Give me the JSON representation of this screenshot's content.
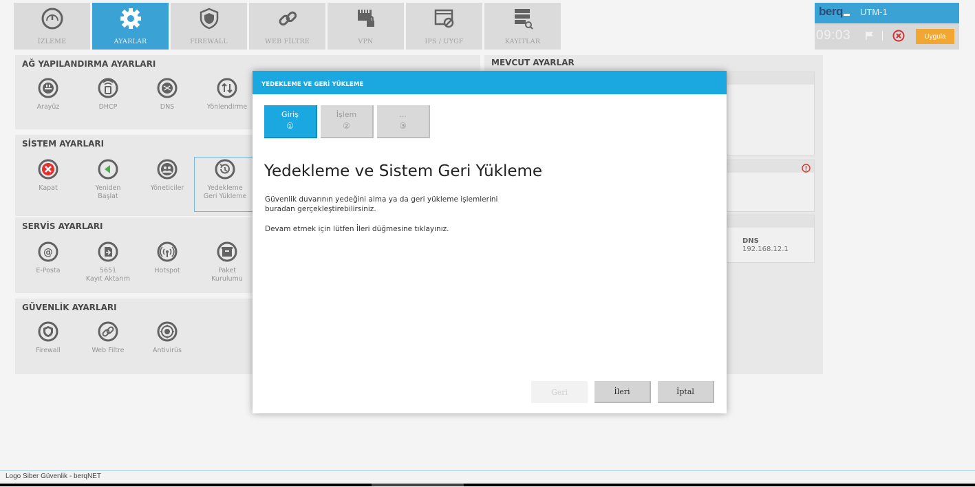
{
  "nav": {
    "items": [
      {
        "label": "İZLEME",
        "icon": "gauge-icon"
      },
      {
        "label": "AYARLAR",
        "icon": "gear-icon"
      },
      {
        "label": "FIREWALL",
        "icon": "shield-icon"
      },
      {
        "label": "WEB FİLTRE",
        "icon": "link-icon"
      },
      {
        "label": "VPN",
        "icon": "network-lock-icon"
      },
      {
        "label": "IPS / UYGF",
        "icon": "window-block-icon"
      },
      {
        "label": "KAYITLAR",
        "icon": "database-search-icon"
      }
    ],
    "active_index": 1
  },
  "brand": {
    "logo": "berq",
    "device": "UTM-1",
    "clock": "09:03",
    "apply_label": "Uygula"
  },
  "sections": {
    "network": {
      "title": "AĞ YAPILANDIRMA AYARLARI",
      "items": [
        {
          "label": "Arayüz",
          "icon": "interface-icon"
        },
        {
          "label": "DHCP",
          "icon": "dhcp-icon"
        },
        {
          "label": "DNS",
          "icon": "dns-icon"
        },
        {
          "label": "Yönlendirme",
          "icon": "routing-icon"
        }
      ]
    },
    "system": {
      "title": "SİSTEM AYARLARI",
      "items": [
        {
          "label": "Kapat",
          "icon": "power-off-icon"
        },
        {
          "label": "Yeniden Başlat",
          "line1": "Yeniden",
          "line2": "Başlat",
          "icon": "restart-icon"
        },
        {
          "label": "Yöneticiler",
          "icon": "admins-icon"
        },
        {
          "label": "Yedekleme Geri Yükleme",
          "line1": "Yedekleme",
          "line2": "Geri Yükleme",
          "icon": "backup-restore-icon"
        }
      ]
    },
    "service": {
      "title": "SERVİS AYARLARI",
      "items": [
        {
          "label": "E-Posta",
          "icon": "email-icon"
        },
        {
          "label": "5651 Kayıt Aktarım",
          "line1": "5651",
          "line2": "Kayıt Aktarım",
          "icon": "log-transfer-icon"
        },
        {
          "label": "Hotspot",
          "icon": "hotspot-icon"
        },
        {
          "label": "Paket Kurulumu",
          "line1": "Paket",
          "line2": "Kurulumu",
          "icon": "package-icon"
        }
      ]
    },
    "security": {
      "title": "GÜVENLİK AYARLARI",
      "items": [
        {
          "label": "Firewall",
          "icon": "shield-icon"
        },
        {
          "label": "Web Filtre",
          "icon": "link-icon"
        },
        {
          "label": "Antivirüs",
          "icon": "antivirus-icon"
        }
      ]
    }
  },
  "current": {
    "title": "MEVCUT AYARLAR",
    "dns_label": "DNS",
    "dns_value": "192.168.12.1"
  },
  "modal": {
    "title": "YEDEKLEME VE GERİ YÜKLEME",
    "steps": [
      {
        "label": "Giriş",
        "num": "①"
      },
      {
        "label": "İşlem",
        "num": "②"
      },
      {
        "label": "...",
        "num": "③"
      }
    ],
    "heading": "Yedekleme ve Sistem Geri Yükleme",
    "paragraph1_line1": "Güvenlik duvarının yedeğini alma ya da geri yükleme işlemlerini",
    "paragraph1_line2": "buradan gerçekleştirebilirsiniz.",
    "paragraph2": "Devam etmek için lütfen İleri düğmesine tıklayınız.",
    "buttons": {
      "back": "Geri",
      "next": "İleri",
      "cancel": "İptal"
    }
  },
  "footer": {
    "text": "Logo Siber Güvenlik - berqNET"
  },
  "colors": {
    "accent": "#1ba7e0",
    "nav_active": "#2a9bd1",
    "apply": "#f0a020",
    "danger": "#e02020"
  }
}
